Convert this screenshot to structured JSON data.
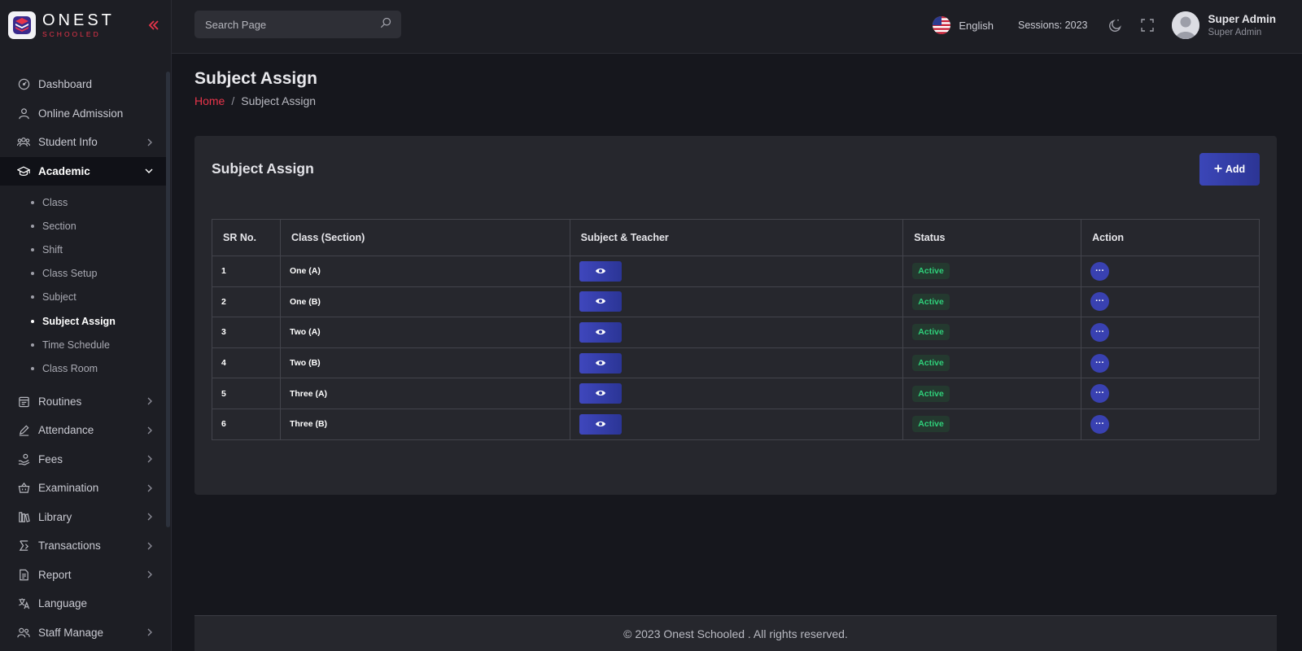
{
  "brand": {
    "name": "ONEST",
    "sub": "SCHOOLED"
  },
  "colors": {
    "accent": "#e8344a",
    "primary": "#3b46b8",
    "status_active": "#2fd07a"
  },
  "sidebar": {
    "items": [
      {
        "label": "Dashboard",
        "icon": "gauge-icon"
      },
      {
        "label": "Online Admission",
        "icon": "user-icon"
      },
      {
        "label": "Student Info",
        "icon": "students-icon"
      },
      {
        "label": "Academic",
        "icon": "graduation-cap-icon"
      },
      {
        "label": "Routines",
        "icon": "calendar-icon"
      },
      {
        "label": "Attendance",
        "icon": "pen-icon"
      },
      {
        "label": "Fees",
        "icon": "hand-coin-icon"
      },
      {
        "label": "Examination",
        "icon": "basket-icon"
      },
      {
        "label": "Library",
        "icon": "books-icon"
      },
      {
        "label": "Transactions",
        "icon": "transaction-icon"
      },
      {
        "label": "Report",
        "icon": "document-icon"
      },
      {
        "label": "Language",
        "icon": "language-icon"
      },
      {
        "label": "Staff Manage",
        "icon": "staff-icon"
      }
    ],
    "academic_sub": [
      "Class",
      "Section",
      "Shift",
      "Class Setup",
      "Subject",
      "Subject Assign",
      "Time Schedule",
      "Class Room"
    ]
  },
  "header": {
    "search_placeholder": "Search Page",
    "language": "English",
    "session": "Sessions: 2023",
    "user_name": "Super Admin",
    "user_role": "Super Admin"
  },
  "page": {
    "title": "Subject Assign",
    "breadcrumb_home": "Home",
    "breadcrumb_sep": "/",
    "breadcrumb_current": "Subject Assign"
  },
  "card": {
    "title": "Subject Assign",
    "add_label": "Add"
  },
  "table": {
    "headers": [
      "SR No.",
      "Class (Section)",
      "Subject & Teacher",
      "Status",
      "Action"
    ],
    "rows": [
      {
        "sr": "1",
        "class": "One (A)",
        "status": "Active"
      },
      {
        "sr": "2",
        "class": "One (B)",
        "status": "Active"
      },
      {
        "sr": "3",
        "class": "Two (A)",
        "status": "Active"
      },
      {
        "sr": "4",
        "class": "Two (B)",
        "status": "Active"
      },
      {
        "sr": "5",
        "class": "Three (A)",
        "status": "Active"
      },
      {
        "sr": "6",
        "class": "Three (B)",
        "status": "Active"
      }
    ]
  },
  "footer": {
    "text": "© 2023 Onest Schooled . All rights reserved."
  }
}
